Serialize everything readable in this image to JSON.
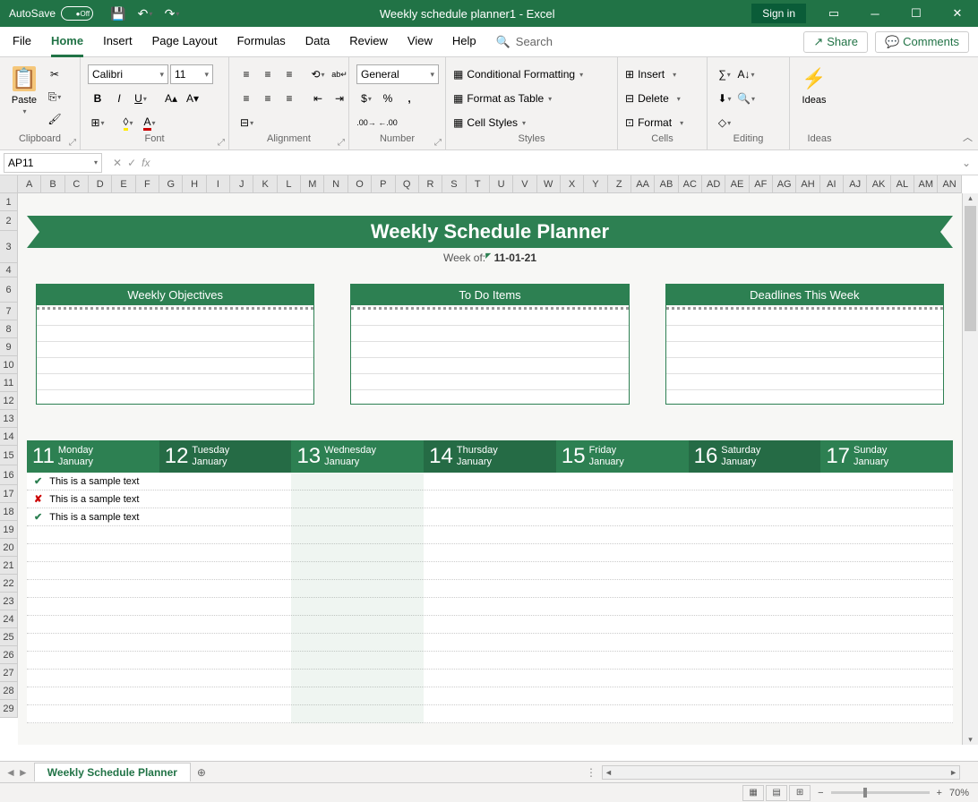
{
  "titlebar": {
    "autosave_label": "AutoSave",
    "autosave_state": "Off",
    "doc_title": "Weekly schedule planner1  -  Excel",
    "signin": "Sign in"
  },
  "tabs": {
    "file": "File",
    "home": "Home",
    "insert": "Insert",
    "page_layout": "Page Layout",
    "formulas": "Formulas",
    "data": "Data",
    "review": "Review",
    "view": "View",
    "help": "Help",
    "search": "Search",
    "share": "Share",
    "comments": "Comments"
  },
  "ribbon": {
    "clipboard": {
      "label": "Clipboard",
      "paste": "Paste"
    },
    "font": {
      "label": "Font",
      "family": "Calibri",
      "size": "11"
    },
    "alignment": {
      "label": "Alignment"
    },
    "number": {
      "label": "Number",
      "format": "General"
    },
    "styles": {
      "label": "Styles",
      "cond": "Conditional Formatting",
      "table": "Format as Table",
      "cell": "Cell Styles"
    },
    "cells": {
      "label": "Cells",
      "insert": "Insert",
      "delete": "Delete",
      "format": "Format"
    },
    "editing": {
      "label": "Editing"
    },
    "ideas": {
      "label": "Ideas",
      "btn": "Ideas"
    }
  },
  "formula_bar": {
    "cell_ref": "AP11",
    "formula": ""
  },
  "columns": [
    "A",
    "B",
    "C",
    "D",
    "E",
    "F",
    "G",
    "H",
    "I",
    "J",
    "K",
    "L",
    "M",
    "N",
    "O",
    "P",
    "Q",
    "R",
    "S",
    "T",
    "U",
    "V",
    "W",
    "X",
    "Y",
    "Z",
    "AA",
    "AB",
    "AC",
    "AD",
    "AE",
    "AF",
    "AG",
    "AH",
    "AI",
    "AJ",
    "AK",
    "AL",
    "AM",
    "AN"
  ],
  "rows": [
    1,
    2,
    3,
    4,
    6,
    7,
    8,
    9,
    10,
    11,
    12,
    13,
    14,
    15,
    16,
    17,
    18,
    19,
    20,
    21,
    22,
    23,
    24,
    25,
    26,
    27,
    28,
    29
  ],
  "row_heights": {
    "default": 20,
    "h2": 22,
    "h3": 36,
    "h4": 16,
    "h6": 28
  },
  "planner": {
    "title": "Weekly Schedule Planner",
    "week_of_label": "Week of:",
    "week_of_value": "11-01-21",
    "boxes": [
      "Weekly Objectives",
      "To Do Items",
      "Deadlines This Week"
    ],
    "days": [
      {
        "num": "11",
        "name": "Monday",
        "month": "January"
      },
      {
        "num": "12",
        "name": "Tuesday",
        "month": "January"
      },
      {
        "num": "13",
        "name": "Wednesday",
        "month": "January"
      },
      {
        "num": "14",
        "name": "Thursday",
        "month": "January"
      },
      {
        "num": "15",
        "name": "Friday",
        "month": "January"
      },
      {
        "num": "16",
        "name": "Saturday",
        "month": "January"
      },
      {
        "num": "17",
        "name": "Sunday",
        "month": "January"
      }
    ],
    "tasks": [
      {
        "status": "done",
        "text": "This is a sample text"
      },
      {
        "status": "no",
        "text": "This is a sample text"
      },
      {
        "status": "done",
        "text": "This is a sample text"
      }
    ]
  },
  "sheet_tab": {
    "name": "Weekly Schedule Planner"
  },
  "status": {
    "zoom": "70%"
  }
}
